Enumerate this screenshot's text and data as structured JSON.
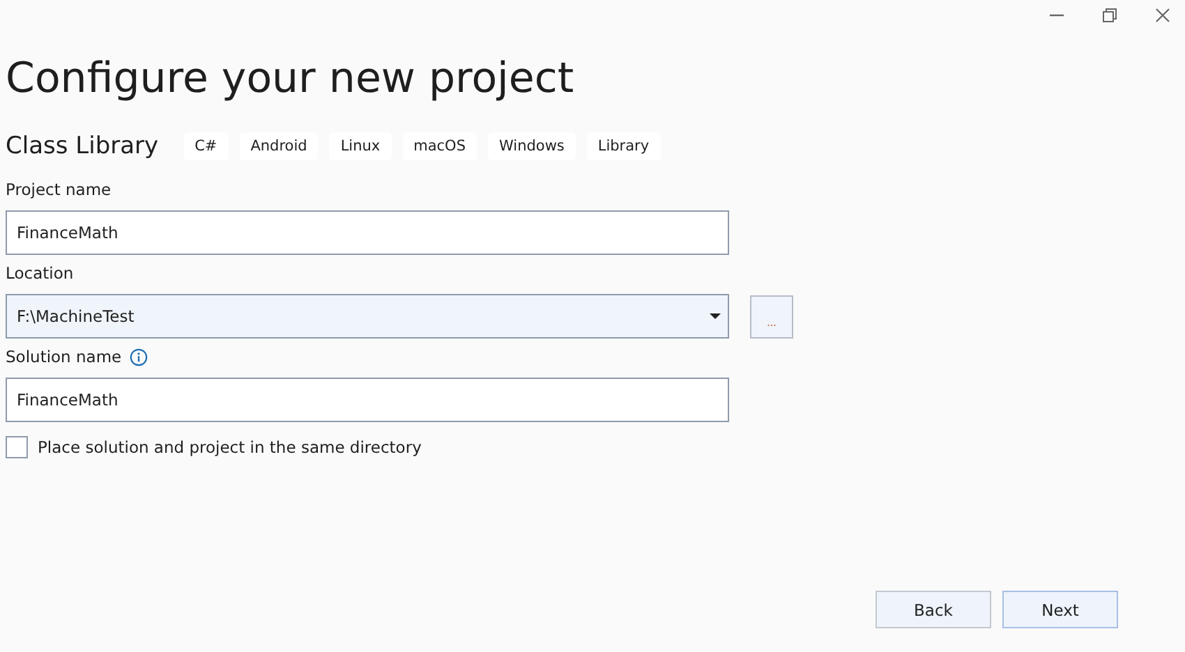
{
  "title": "Configure your new project",
  "template": {
    "name": "Class Library",
    "tags": [
      "C#",
      "Android",
      "Linux",
      "macOS",
      "Windows",
      "Library"
    ]
  },
  "fields": [
    {
      "kind": "text",
      "label": "Project name",
      "value": "FinanceMath",
      "info": false
    },
    {
      "kind": "combo",
      "label": "Location",
      "value": "F:\\MachineTest",
      "browse": "...",
      "info": false
    },
    {
      "kind": "text",
      "label": "Solution name",
      "value": "FinanceMath",
      "info": true
    }
  ],
  "same_directory": {
    "label": "Place solution and project in the same directory",
    "checked": false
  },
  "buttons": [
    {
      "label": "Back",
      "primary": false
    },
    {
      "label": "Next",
      "primary": true
    }
  ]
}
